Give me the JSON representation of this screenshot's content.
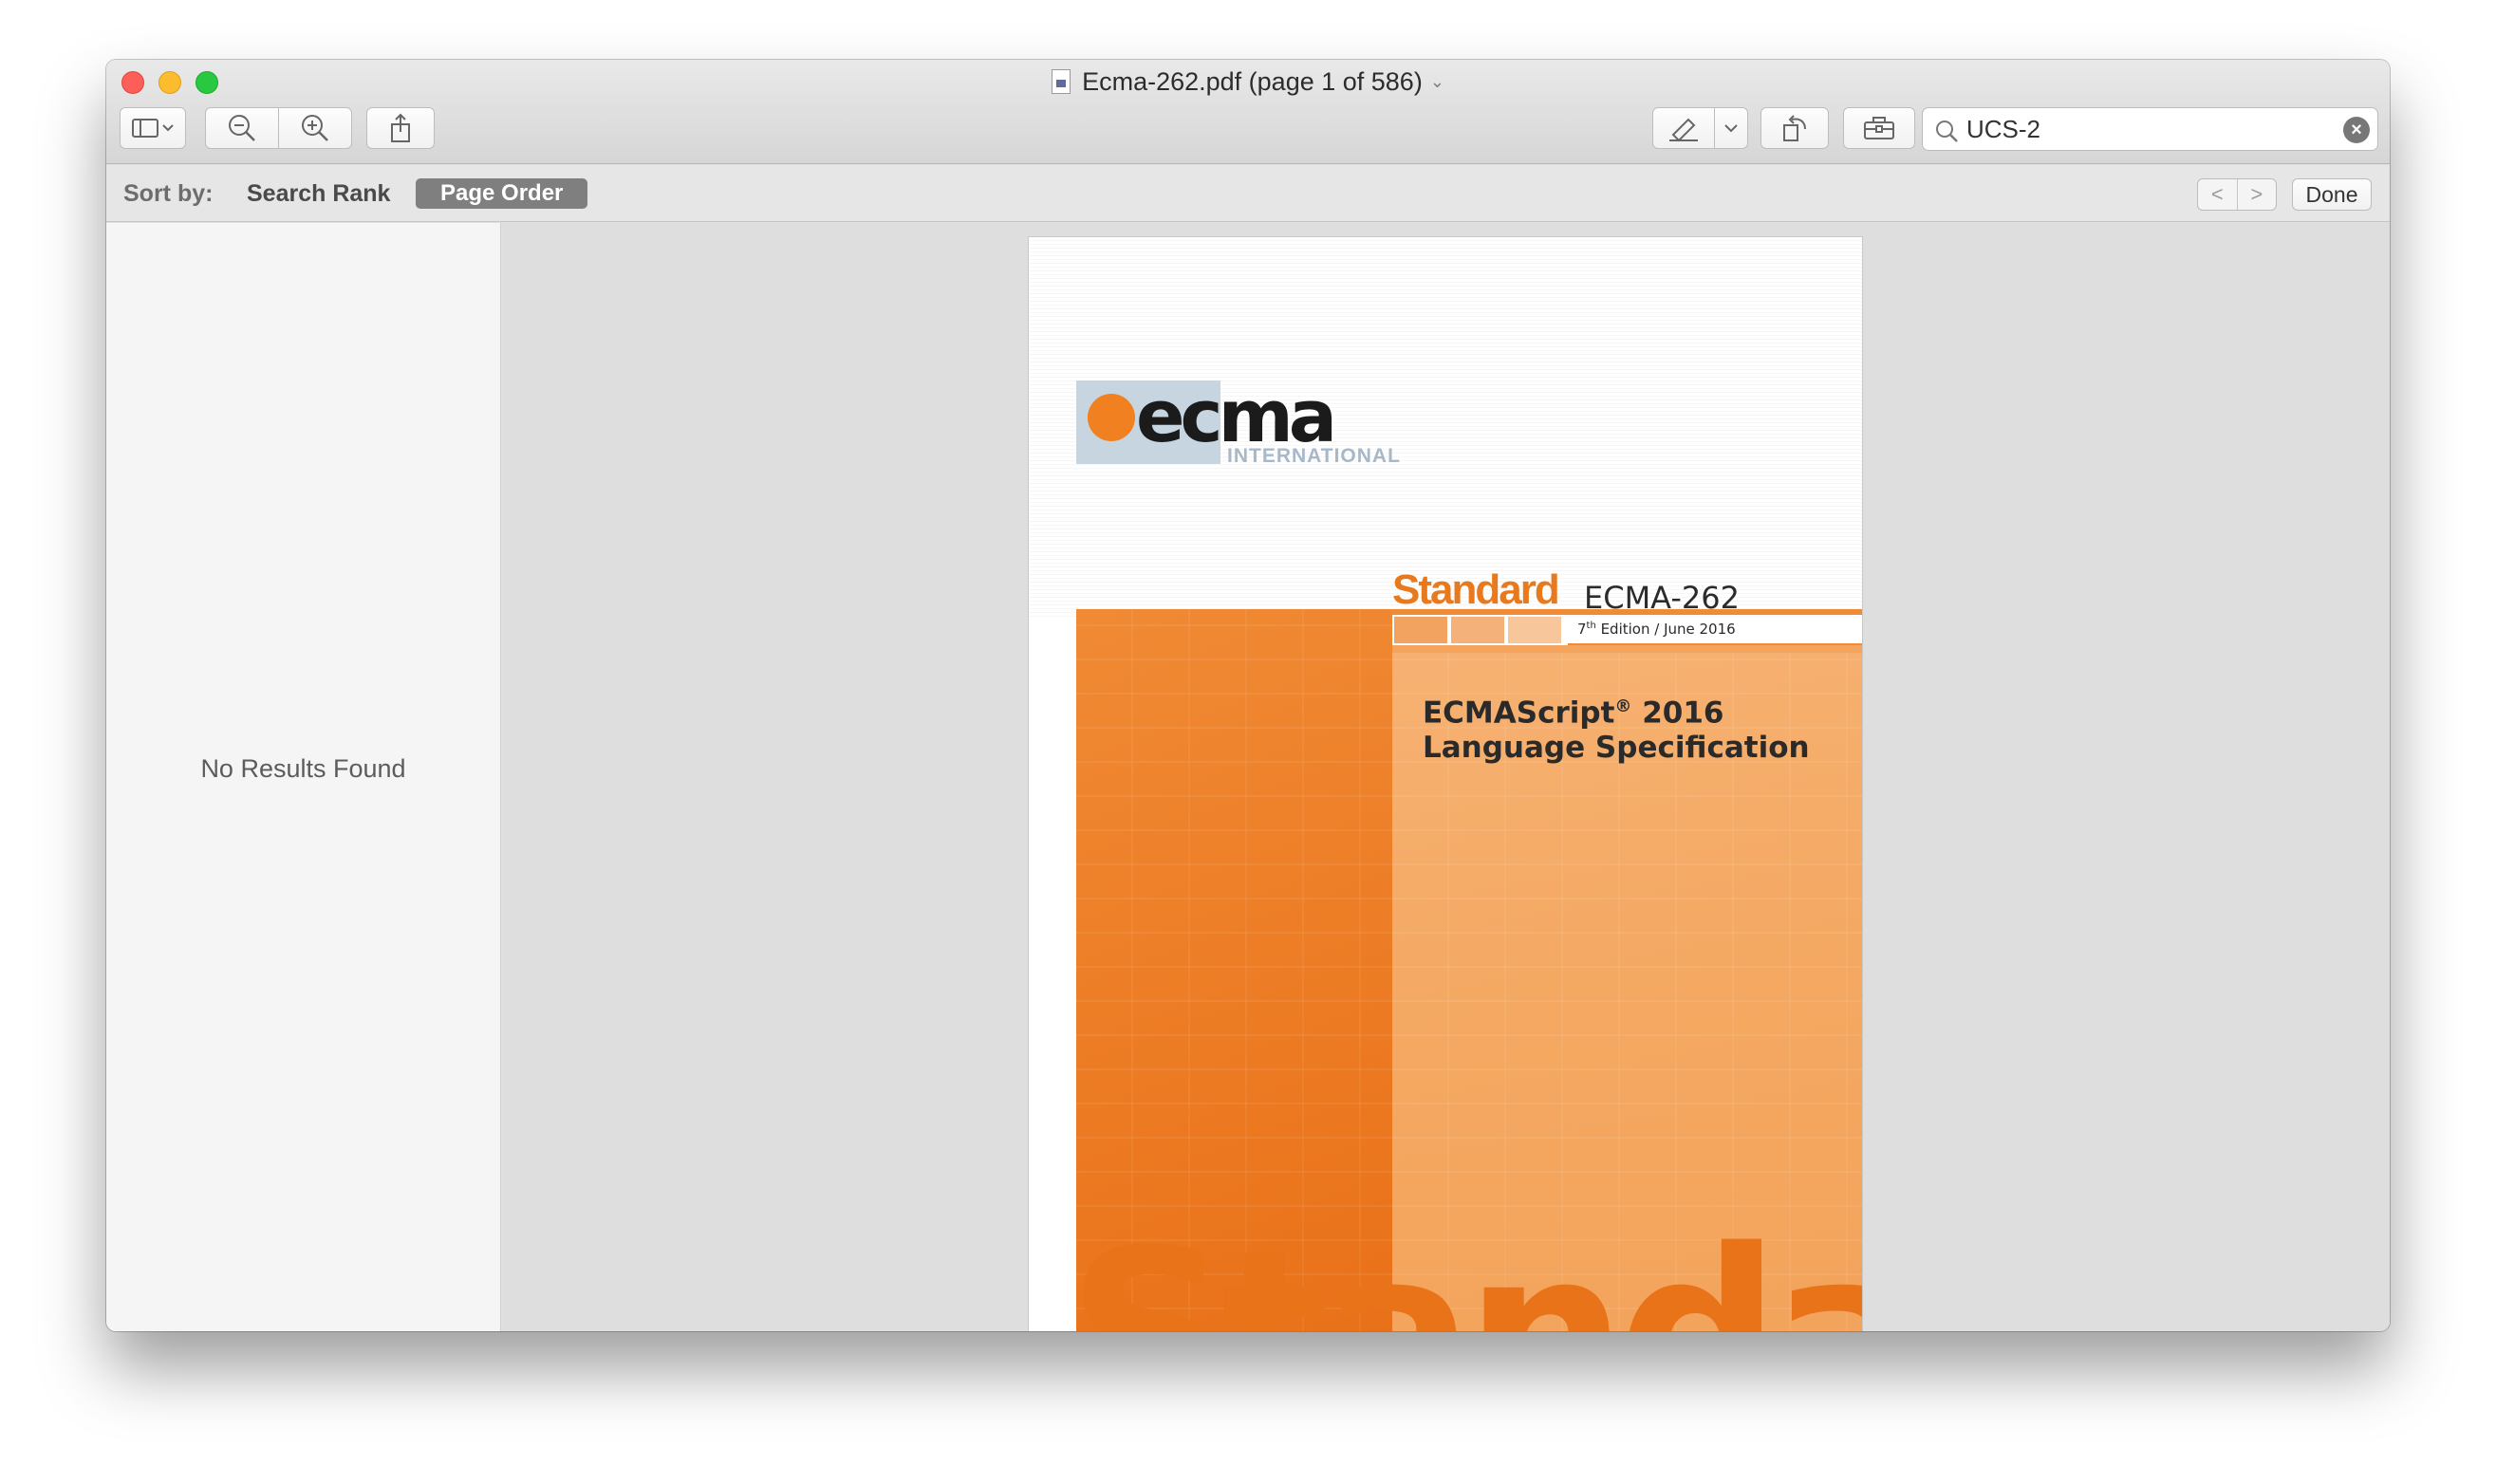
{
  "window": {
    "title": "Ecma-262.pdf (page 1 of 586)",
    "title_chevron": "⌄"
  },
  "toolbar": {
    "sidebar_toggle_icon": "sidebar-icon",
    "zoom_out_icon": "zoom-out-icon",
    "zoom_in_icon": "zoom-in-icon",
    "share_icon": "share-icon",
    "markup_icon": "highlighter-icon",
    "rotate_icon": "rotate-icon",
    "toolbox_icon": "toolbox-icon"
  },
  "search": {
    "query": "UCS-2",
    "clear_glyph": "×"
  },
  "findbar": {
    "sort_by_label": "Sort by:",
    "search_rank_label": "Search Rank",
    "page_order_label": "Page Order",
    "prev_glyph": "<",
    "next_glyph": ">",
    "done_label": "Done"
  },
  "sidebar": {
    "empty_message": "No Results Found"
  },
  "document": {
    "logo_word": "ecma",
    "logo_sub": "INTERNATIONAL",
    "standard_label": "Standard",
    "standard_number": "ECMA-262",
    "edition_prefix": "7",
    "edition_sup": "th",
    "edition_rest": " Edition / June 2016",
    "spec_title_line1": "ECMAScript",
    "spec_title_reg": "®",
    "spec_title_year": " 2016",
    "spec_title_line2": "Language Specification",
    "big_word": "Standard"
  },
  "colors": {
    "accent_orange": "#e8791c",
    "light_orange": "#f4a861",
    "logo_blue": "#c7d5e0"
  }
}
